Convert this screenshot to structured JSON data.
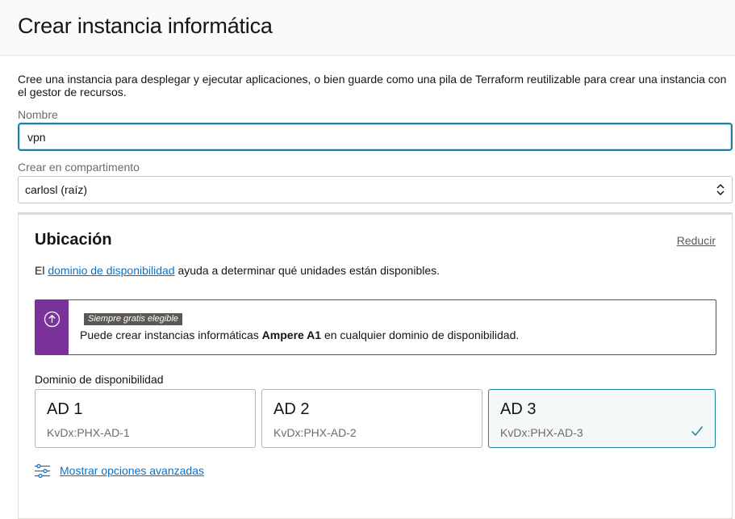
{
  "header": {
    "title": "Crear instancia informática"
  },
  "intro": "Cree una instancia para desplegar y ejecutar aplicaciones, o bien guarde como una pila de Terraform reutilizable para crear una instancia con el gestor de recursos.",
  "name_field": {
    "label": "Nombre",
    "value": "vpn"
  },
  "compartment": {
    "label": "Crear en compartimento",
    "value": "carlosl (raíz)"
  },
  "placement": {
    "title": "Ubicación",
    "collapse_label": "Reducir",
    "help_prefix": "El ",
    "help_link": "dominio de disponibilidad",
    "help_suffix": " ayuda a determinar qué unidades están disponibles.",
    "notice": {
      "badge": "Siempre gratis elegible",
      "text_prefix": "Puede crear instancias informáticas ",
      "text_bold": "Ampere A1",
      "text_suffix": " en cualquier dominio de disponibilidad."
    },
    "ad_label": "Dominio de disponibilidad",
    "ads": [
      {
        "name": "AD 1",
        "id": "KvDx:PHX-AD-1",
        "selected": false
      },
      {
        "name": "AD 2",
        "id": "KvDx:PHX-AD-2",
        "selected": false
      },
      {
        "name": "AD 3",
        "id": "KvDx:PHX-AD-3",
        "selected": true
      }
    ],
    "advanced_link": "Mostrar opciones avanzadas"
  },
  "colors": {
    "accent": "#227e9e",
    "link": "#0572ce",
    "notice": "#7b3399"
  },
  "icons": {
    "notice": "circle-arrow-up-icon",
    "selected": "checkmark-icon",
    "select": "chevron-updown-icon",
    "advanced": "sliders-icon"
  }
}
